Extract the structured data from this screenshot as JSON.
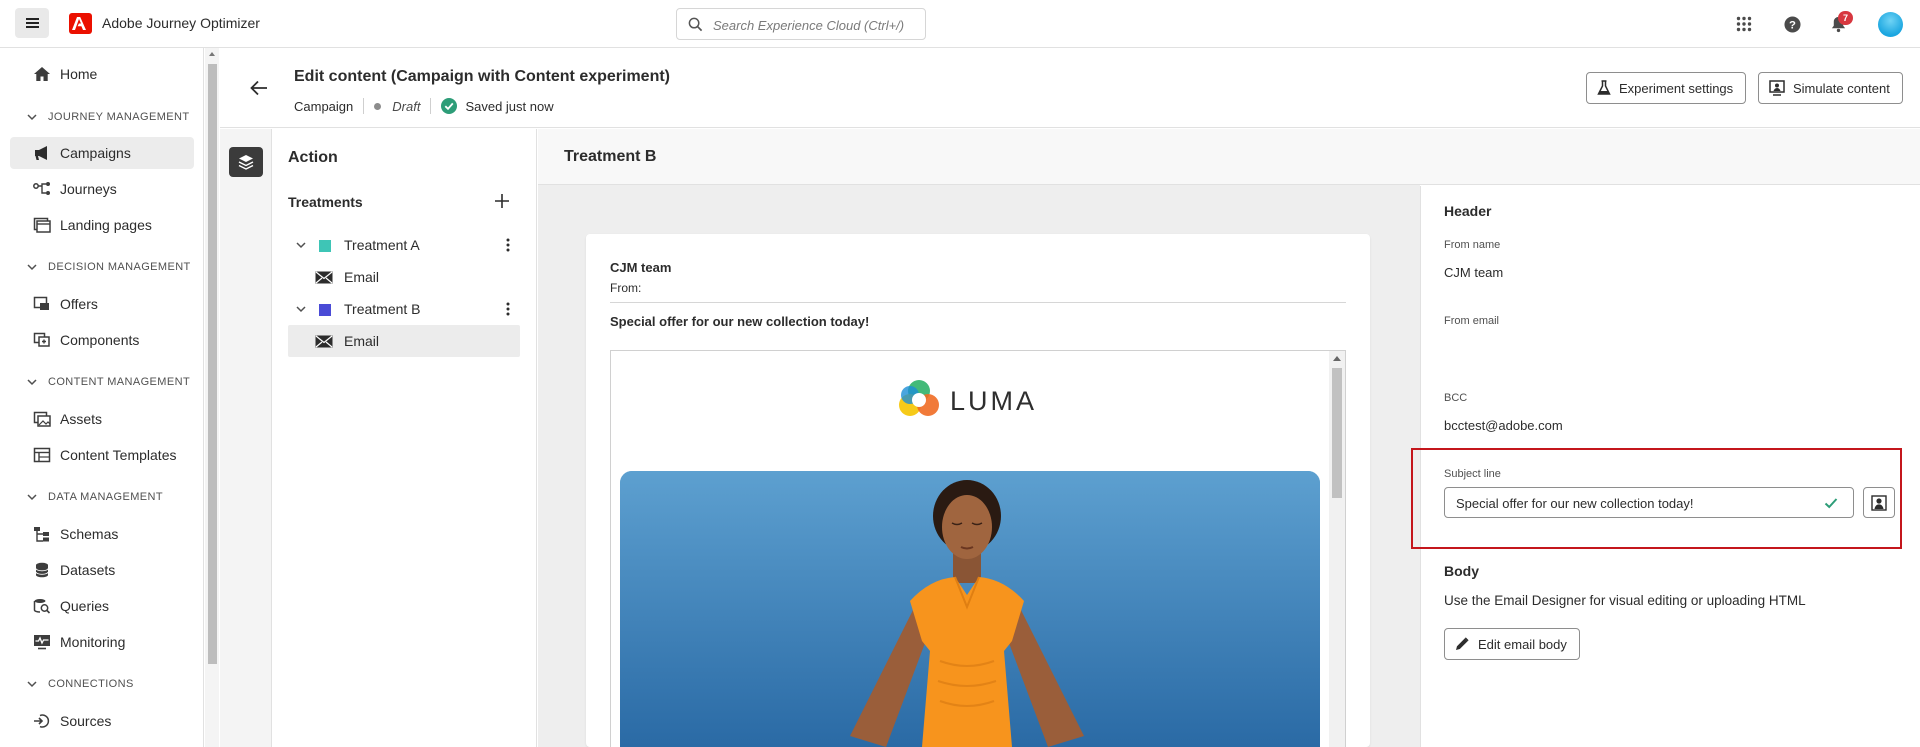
{
  "app": {
    "title": "Adobe Journey Optimizer"
  },
  "search": {
    "placeholder": "Search Experience Cloud (Ctrl+/)"
  },
  "topbar": {
    "notification_count": "7",
    "icons": [
      "apps-grid-icon",
      "help-icon",
      "bell-icon"
    ]
  },
  "sidebar": {
    "home": "Home",
    "sections": [
      {
        "label": "JOURNEY MANAGEMENT",
        "items": [
          "Campaigns",
          "Journeys",
          "Landing pages"
        ]
      },
      {
        "label": "DECISION MANAGEMENT",
        "items": [
          "Offers",
          "Components"
        ]
      },
      {
        "label": "CONTENT MANAGEMENT",
        "items": [
          "Assets",
          "Content Templates"
        ]
      },
      {
        "label": "DATA MANAGEMENT",
        "items": [
          "Schemas",
          "Datasets",
          "Queries",
          "Monitoring"
        ]
      },
      {
        "label": "CONNECTIONS",
        "items": [
          "Sources"
        ]
      }
    ],
    "active_item": "Campaigns"
  },
  "header": {
    "title": "Edit content (Campaign with Content experiment)",
    "type": "Campaign",
    "status": "Draft",
    "saved": "Saved just now",
    "experiment_settings": "Experiment settings",
    "simulate_content": "Simulate content"
  },
  "action_panel": {
    "title": "Action",
    "treatments_label": "Treatments",
    "treatments": [
      {
        "name": "Treatment A",
        "color": "#3ec5b6",
        "channel": "Email"
      },
      {
        "name": "Treatment B",
        "color": "#4a4bd6",
        "channel": "Email"
      }
    ],
    "selected": "Treatment B / Email"
  },
  "preview": {
    "title": "Treatment B",
    "from_name": "CJM team",
    "from_label": "From:",
    "subject": "Special offer for our new collection today!",
    "brand": "LUMA"
  },
  "properties": {
    "header_title": "Header",
    "from_name_label": "From name",
    "from_name_value": "CJM team",
    "from_email_label": "From email",
    "bcc_label": "BCC",
    "bcc_value": "bcctest@adobe.com",
    "subject_label": "Subject line",
    "subject_value": "Special offer for our new collection today!",
    "body_title": "Body",
    "body_desc": "Use the Email Designer for visual editing or uploading HTML",
    "edit_body": "Edit email body"
  }
}
